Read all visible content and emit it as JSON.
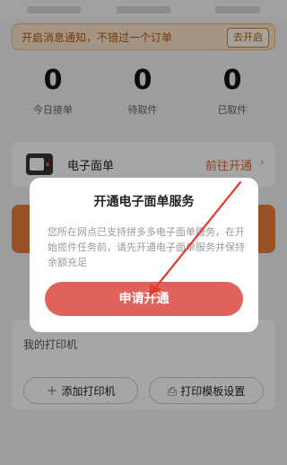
{
  "notice": {
    "text": "开启消息通知，不错过一个订单",
    "button": "去开启"
  },
  "stats": [
    {
      "value": "0",
      "label": "今日接单"
    },
    {
      "value": "0",
      "label": "待取件"
    },
    {
      "value": "0",
      "label": "已取件"
    }
  ],
  "waybill_card": {
    "title": "电子面单",
    "action": "前往开通",
    "chevron": "›"
  },
  "printer": {
    "section_label": "我的打印机",
    "add_button": "添加打印机",
    "template_button": "打印模板设置",
    "add_icon": "＋",
    "template_icon": "⎙"
  },
  "modal": {
    "title": "开通电子面单服务",
    "body": "您所在网点已支持拼多多电子面单服务，在开始揽件任务前，请先开通电子面单服务并保持余额充足",
    "confirm": "申请开通"
  },
  "colors": {
    "accent": "#e0635b",
    "orange": "#e0672c",
    "annotation_arrow": "#e23b2e"
  }
}
